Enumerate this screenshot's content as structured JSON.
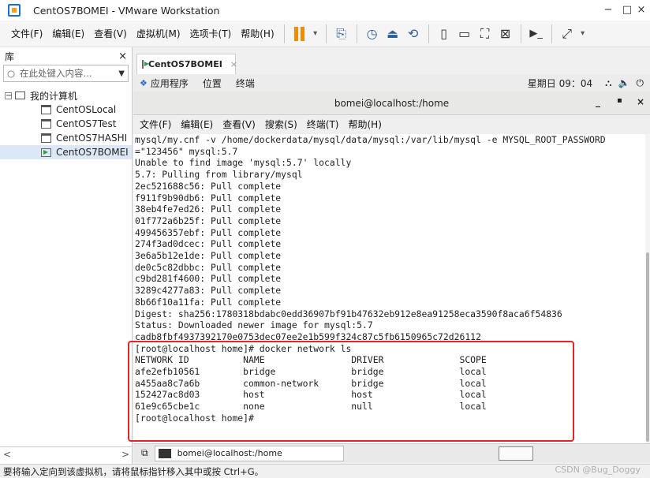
{
  "window": {
    "title": "CentOS7BOMEI - VMware Workstation",
    "min": "−",
    "max": "□",
    "close": "×"
  },
  "menu": [
    "文件(F)",
    "编辑(E)",
    "查看(V)",
    "虚拟机(M)",
    "选项卡(T)",
    "帮助(H)"
  ],
  "library": {
    "title": "库",
    "close": "×",
    "search_placeholder": "在此处键入内容...",
    "root": "我的计算机",
    "vms": [
      "CentOSLocal",
      "CentOS7Test",
      "CentOS7HASHI",
      "CentOS7BOMEI"
    ],
    "scroll_left": "<",
    "scroll_right": ">"
  },
  "tab": {
    "label": "CentOS7BOMEI",
    "close": "×"
  },
  "gnome": {
    "apps": "应用程序",
    "places": "位置",
    "terminal": "终端",
    "clock": "星期日 09：04"
  },
  "terminal": {
    "title": "bomei@localhost:/home",
    "menu": [
      "文件(F)",
      "编辑(E)",
      "查看(V)",
      "搜索(S)",
      "终端(T)",
      "帮助(H)"
    ],
    "lines": [
      "mysql/my.cnf -v /home/dockerdata/mysql/data/mysql:/var/lib/mysql -e MYSQL_ROOT_PASSWORD",
      "=\"123456\" mysql:5.7",
      "Unable to find image 'mysql:5.7' locally",
      "5.7: Pulling from library/mysql",
      "2ec521688c56: Pull complete",
      "f911f9b90db6: Pull complete",
      "38eb4fe7ed26: Pull complete",
      "01f772a6b25f: Pull complete",
      "499456357ebf: Pull complete",
      "274f3ad0dcec: Pull complete",
      "3e6a5b12e1de: Pull complete",
      "de0c5c82dbbc: Pull complete",
      "c9bd281f4600: Pull complete",
      "3289c4277a83: Pull complete",
      "8b66f10a11fa: Pull complete",
      "Digest: sha256:1780318bdabc0edd36907bf91b47632eb912e8ea91258eca3590f8aca6f54836",
      "Status: Downloaded newer image for mysql:5.7",
      "cadb8fbf4937392170e0753dec07ee2e1b599f324c87c5fb6150965c72d26112",
      "[root@localhost home]# docker network ls",
      "NETWORK ID          NAME                DRIVER              SCOPE",
      "afe2efb10561        bridge              bridge              local",
      "a455aa8c7a6b        common-network      bridge              local",
      "152427ac8d03        host                host                local",
      "61e9c65cbe1c        none                null                local",
      "[root@localhost home]# "
    ]
  },
  "taskbar": {
    "item": "bomei@localhost:/home"
  },
  "status": {
    "message": "要将输入定向到该虚拟机，请将鼠标指针移入其中或按 Ctrl+G。",
    "watermark": "CSDN @Bug_Doggy"
  }
}
